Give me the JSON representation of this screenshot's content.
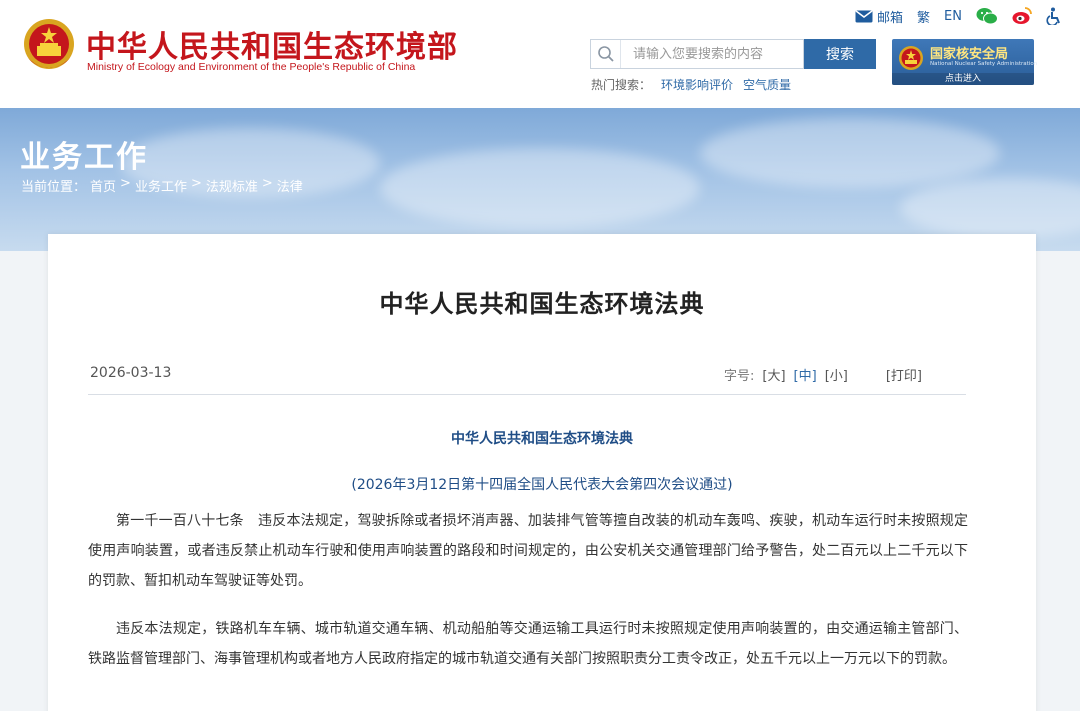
{
  "header": {
    "site_title": "中华人民共和国生态环境部",
    "site_subtitle": "Ministry of Ecology and Environment of the People's Republic of China",
    "topbar": {
      "mail": "邮箱",
      "traditional": "繁",
      "english": "EN"
    },
    "search": {
      "placeholder": "请输入您要搜索的内容",
      "button": "搜索"
    },
    "hot_search": {
      "label": "热门搜索：",
      "items": [
        "环境影响评价",
        "空气质量"
      ]
    },
    "nnsa": {
      "name": "国家核安全局",
      "en": "National Nuclear Safety Administration",
      "enter": "点击进入"
    }
  },
  "banner": {
    "title": "业务工作",
    "breadcrumb": {
      "label": "当前位置：",
      "items": [
        "首页",
        "业务工作",
        "法规标准",
        "法律"
      ],
      "separator": ">"
    }
  },
  "article": {
    "title": "中华人民共和国生态环境法典",
    "date": "2026-03-13",
    "font_size_label": "字号:",
    "sizes": [
      "[大]",
      "[中]",
      "[小]"
    ],
    "print": "[打印]",
    "doc_heading": "中华人民共和国生态环境法典",
    "doc_sub": "(2026年3月12日第十四届全国人民代表大会第四次会议通过)",
    "paragraphs": [
      "第一千一百八十七条　违反本法规定，驾驶拆除或者损坏消声器、加装排气管等擅自改装的机动车轰鸣、疾驶，机动车运行时未按照规定使用声响装置，或者违反禁止机动车行驶和使用声响装置的路段和时间规定的，由公安机关交通管理部门给予警告，处二百元以上二千元以下的罚款、暂扣机动车驾驶证等处罚。",
      "违反本法规定，铁路机车车辆、城市轨道交通车辆、机动船舶等交通运输工具运行时未按照规定使用声响装置的，由交通运输主管部门、铁路监督管理部门、海事管理机构或者地方人民政府指定的城市轨道交通有关部门按照职责分工责令改正，处五千元以上一万元以下的罚款。"
    ]
  },
  "colors": {
    "brand_red": "#c4161c",
    "link_blue": "#2f6aa7",
    "heading_blue": "#1f4d86"
  }
}
